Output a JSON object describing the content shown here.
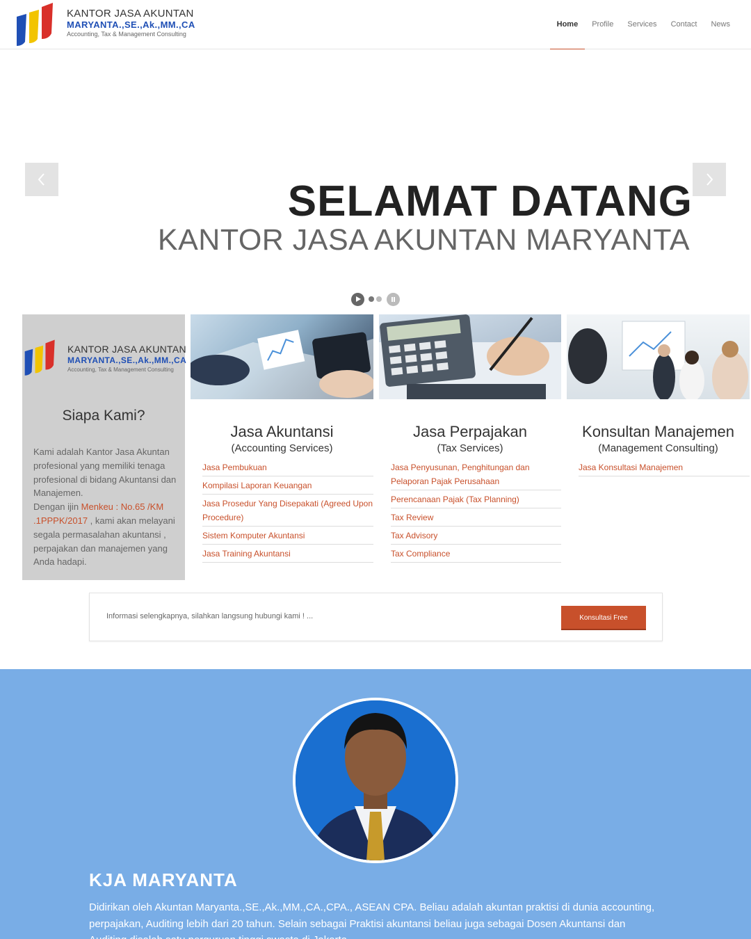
{
  "header": {
    "logo": {
      "line1": "KANTOR JASA AKUNTAN",
      "line2": "MARYANTA.,SE.,Ak.,MM.,CA",
      "line3": "Accounting, Tax & Management Consulting"
    },
    "nav": [
      {
        "label": "Home",
        "active": true
      },
      {
        "label": "Profile",
        "active": false
      },
      {
        "label": "Services",
        "active": false
      },
      {
        "label": "Contact",
        "active": false
      },
      {
        "label": "News",
        "active": false
      }
    ]
  },
  "slider": {
    "heading": "SELAMAT DATANG",
    "subheading": "KANTOR JASA AKUNTAN MARYANTA",
    "arrow_left_icon": "chevron-left-icon",
    "arrow_right_icon": "chevron-right-icon"
  },
  "about": {
    "logo": {
      "line1": "KANTOR JASA AKUNTAN",
      "line2": "MARYANTA.,SE.,Ak.,MM.,CA",
      "line3": "Accounting, Tax & Management Consulting"
    },
    "title": "Siapa Kami?",
    "text_before": "Kami adalah Kantor Jasa Akuntan profesional yang memiliki tenaga profesional di bidang Akuntansi dan Manajemen.",
    "text_license_prefix": "Dengan  ijin ",
    "text_license_highlight": "Menkeu : No.65 /KM .1PPPK/2017",
    "text_after": " , kami akan melayani segala permasalahan akuntansi , perpajakan dan manajemen yang Anda hadapi."
  },
  "services": [
    {
      "title": "Jasa Akuntansi",
      "subtitle": "(Accounting Services)",
      "items": [
        "Jasa Pembukuan",
        "Kompilasi Laporan Keuangan",
        "Jasa Prosedur Yang Disepakati (Agreed Upon Procedure)",
        "Sistem Komputer Akuntansi",
        "Jasa Training Akuntansi"
      ]
    },
    {
      "title": "Jasa Perpajakan",
      "subtitle": "(Tax Services)",
      "items": [
        "Jasa Penyusunan, Penghitungan dan Pelaporan Pajak Perusahaan",
        "Perencanaan Pajak (Tax Planning)",
        "Tax Review",
        "Tax Advisory",
        "Tax Compliance"
      ]
    },
    {
      "title": "Konsultan Manajemen",
      "subtitle": "(Management Consulting)",
      "items": [
        "Jasa Konsultasi Manajemen"
      ]
    }
  ],
  "cta": {
    "text": "Informasi selengkapnya, silahkan langsung hubungi kami ! ...",
    "button": "Konsultasi Free"
  },
  "profile": {
    "title": "KJA MARYANTA",
    "text": "Didirikan oleh Akuntan Maryanta.,SE.,Ak.,MM.,CA.,CPA., ASEAN CPA. Beliau adalah akuntan praktisi di dunia accounting, perpajakan, Auditing lebih dari 20 tahun. Selain sebagai Praktisi akuntansi beliau juga sebagai Dosen Akuntansi dan Auditing disalah satu perguruan tinggi swasta di Jakarta."
  },
  "colors": {
    "accent": "#c8502b",
    "profile_bg": "#79ade6",
    "about_bg": "#cfcfcf"
  }
}
